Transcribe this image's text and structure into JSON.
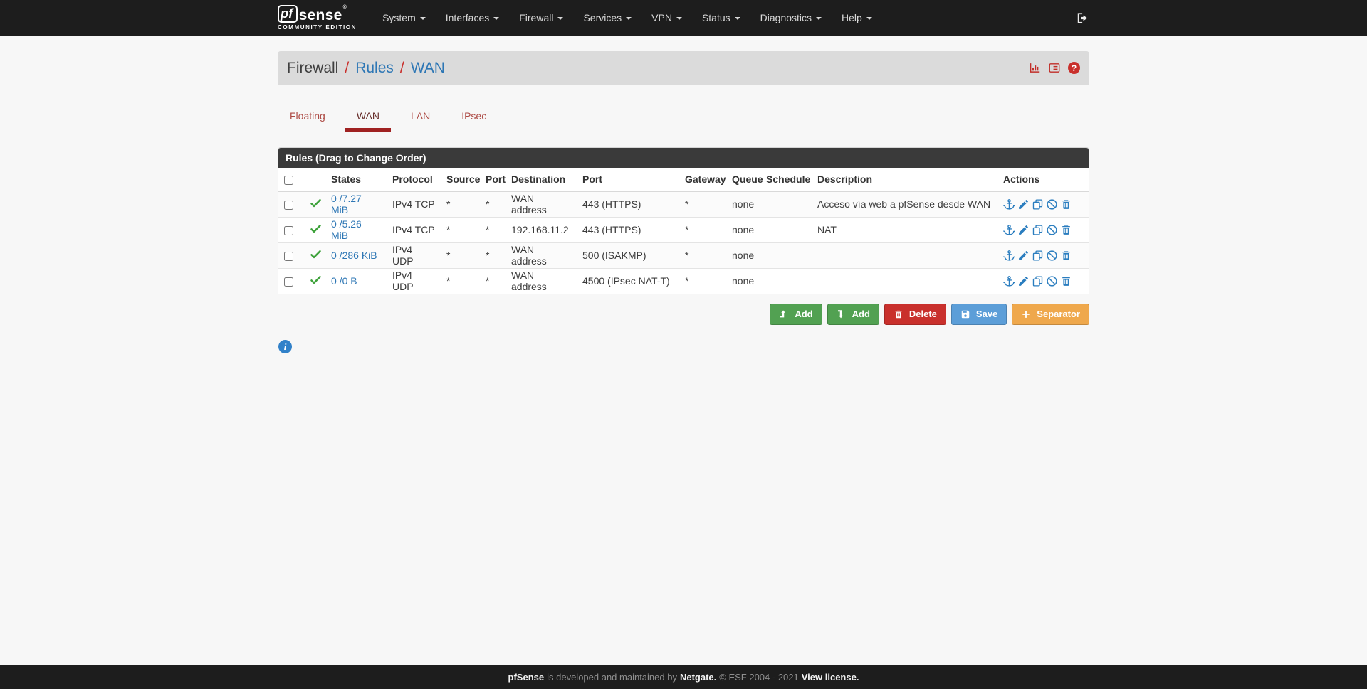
{
  "navbar": {
    "logo": {
      "pf": "pf",
      "sense": "sense",
      "registered": "®",
      "edition": "COMMUNITY EDITION"
    },
    "items": [
      {
        "label": "System"
      },
      {
        "label": "Interfaces"
      },
      {
        "label": "Firewall"
      },
      {
        "label": "Services"
      },
      {
        "label": "VPN"
      },
      {
        "label": "Status"
      },
      {
        "label": "Diagnostics"
      },
      {
        "label": "Help"
      }
    ],
    "logout_icon": "sign-out-icon"
  },
  "breadcrumb": {
    "section": "Firewall",
    "sep1": "/",
    "page": "Rules",
    "sep2": "/",
    "subpage": "WAN",
    "icons": [
      "bar-chart-icon",
      "log-list-icon",
      "help-question-icon"
    ]
  },
  "tabs": [
    {
      "label": "Floating",
      "active": false
    },
    {
      "label": "WAN",
      "active": true
    },
    {
      "label": "LAN",
      "active": false
    },
    {
      "label": "IPsec",
      "active": false
    }
  ],
  "panel": {
    "title": "Rules (Drag to Change Order)"
  },
  "table": {
    "headers": {
      "states": "States",
      "protocol": "Protocol",
      "source": "Source",
      "src_port": "Port",
      "destination": "Destination",
      "dst_port": "Port",
      "gateway": "Gateway",
      "queue": "Queue",
      "schedule": "Schedule",
      "description": "Description",
      "actions": "Actions"
    },
    "row_status_icon": "pass-check-icon",
    "action_icon_names": [
      "anchor-icon",
      "pencil-edit-icon",
      "copy-icon",
      "ban-disable-icon",
      "trash-delete-icon"
    ],
    "rows": [
      {
        "states": "0 /7.27 MiB",
        "protocol": "IPv4 TCP",
        "source": "*",
        "src_port": "*",
        "destination": "WAN address",
        "dst_port": "443 (HTTPS)",
        "gateway": "*",
        "queue": "none",
        "schedule": "",
        "description": "Acceso vía web a pfSense desde WAN"
      },
      {
        "states": "0 /5.26 MiB",
        "protocol": "IPv4 TCP",
        "source": "*",
        "src_port": "*",
        "destination": "192.168.11.2",
        "dst_port": "443 (HTTPS)",
        "gateway": "*",
        "queue": "none",
        "schedule": "",
        "description": "NAT"
      },
      {
        "states": "0 /286 KiB",
        "protocol": "IPv4 UDP",
        "source": "*",
        "src_port": "*",
        "destination": "WAN address",
        "dst_port": "500 (ISAKMP)",
        "gateway": "*",
        "queue": "none",
        "schedule": "",
        "description": ""
      },
      {
        "states": "0 /0 B",
        "protocol": "IPv4 UDP",
        "source": "*",
        "src_port": "*",
        "destination": "WAN address",
        "dst_port": "4500 (IPsec NAT-T)",
        "gateway": "*",
        "queue": "none",
        "schedule": "",
        "description": ""
      }
    ]
  },
  "actions_bar": {
    "add_top": "Add",
    "add_bottom": "Add",
    "delete": "Delete",
    "save": "Save",
    "separator": "Separator"
  },
  "footer": {
    "brand": "pfSense",
    "text1": "is developed and maintained by",
    "company": "Netgate.",
    "copyright": "© ESF 2004 - 2021",
    "license": "View license."
  },
  "colors": {
    "navbar_bg": "#1d1d1d",
    "breadcrumb_bg": "#dbdbdb",
    "accent_red": "#c9302c",
    "link_blue": "#2e77b5",
    "tab_underline_red": "#a02222",
    "pass_green": "#3ea23b",
    "action_icon_blue": "#2a7dbf",
    "btn_green": "#52a152",
    "btn_red": "#c9302c",
    "btn_blue": "#5c9ed8",
    "btn_orange": "#efa84c",
    "panel_heading_bg": "#3a3a3a"
  }
}
